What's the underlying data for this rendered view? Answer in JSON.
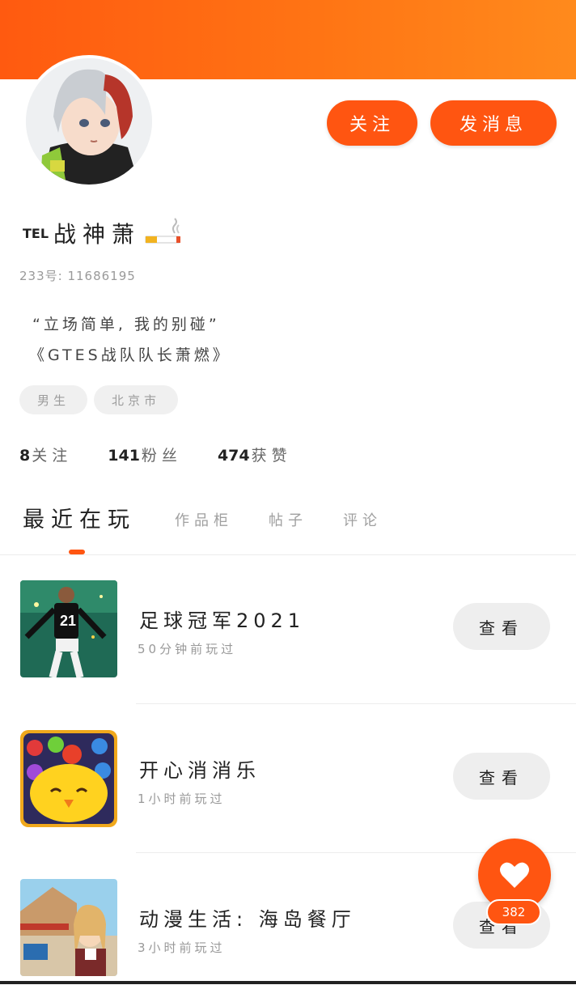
{
  "profile": {
    "name_prefix": "TEL",
    "name": "战神萧",
    "uid": "233号: 11686195",
    "bio_line1": "“立场简单, 我的别碰”",
    "bio_line2": "《GTES战队队长萧燃》",
    "tags": [
      "男生",
      "北京市"
    ],
    "badge_icon": "cigarette-icon"
  },
  "actions": {
    "follow_label": "关注",
    "message_label": "发消息"
  },
  "stats": [
    {
      "num": "8",
      "label": "关注"
    },
    {
      "num": "141",
      "label": "粉丝"
    },
    {
      "num": "474",
      "label": "获赞"
    }
  ],
  "tabs": [
    {
      "label": "最近在玩"
    },
    {
      "label": "作品柜"
    },
    {
      "label": "帖子"
    },
    {
      "label": "评论"
    }
  ],
  "games": [
    {
      "title": "足球冠军2021",
      "time": "50分钟前玩过",
      "view_label": "查看"
    },
    {
      "title": "开心消消乐",
      "time": "1小时前玩过",
      "view_label": "查看"
    },
    {
      "title": "动漫生活: 海岛餐厅",
      "time": "3小时前玩过",
      "view_label": "查看"
    }
  ],
  "fab": {
    "count": "382",
    "icon": "heart-icon"
  },
  "colors": {
    "accent": "#ff5511",
    "header_start": "#ff5a10",
    "header_end": "#ff8a1c"
  }
}
